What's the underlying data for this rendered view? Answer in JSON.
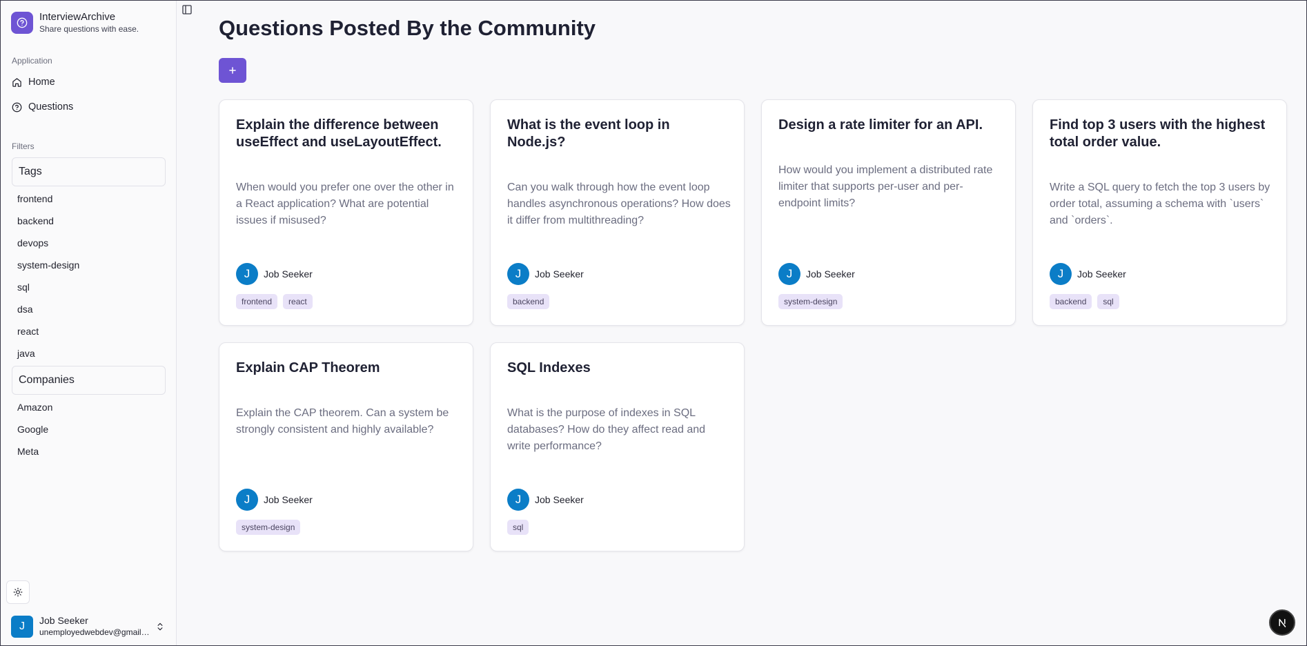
{
  "brand": {
    "name": "InterviewArchive",
    "tagline": "Share questions with ease.",
    "logo_icon": "question-circle-icon",
    "accent": "#6e54d4"
  },
  "sidebar": {
    "application_label": "Application",
    "nav": [
      {
        "label": "Home",
        "icon": "home-icon"
      },
      {
        "label": "Questions",
        "icon": "question-circle-icon"
      }
    ],
    "filters_label": "Filters",
    "tags_header": "Tags",
    "tags": [
      "frontend",
      "backend",
      "devops",
      "system-design",
      "sql",
      "dsa",
      "react",
      "java"
    ],
    "companies_header": "Companies",
    "companies": [
      "Amazon",
      "Google",
      "Meta"
    ],
    "theme_icon": "sun-icon"
  },
  "user": {
    "initial": "J",
    "name": "Job Seeker",
    "email": "unemployedwebdev@gmail.com",
    "avatar_color": "#0b7dc7"
  },
  "main": {
    "title": "Questions Posted By the Community",
    "add_icon": "plus-icon",
    "cards": [
      {
        "title": "Explain the difference between useEffect and useLayoutEffect.",
        "description": "When would you prefer one over the other in a React application? What are potential issues if misused?",
        "author_initial": "J",
        "author": "Job Seeker",
        "tags": [
          "frontend",
          "react"
        ]
      },
      {
        "title": "What is the event loop in Node.js?",
        "description": "Can you walk through how the event loop handles asynchronous operations? How does it differ from multithreading?",
        "author_initial": "J",
        "author": "Job Seeker",
        "tags": [
          "backend"
        ]
      },
      {
        "title": "Design a rate limiter for an API.",
        "description": "How would you implement a distributed rate limiter that supports per-user and per-endpoint limits?",
        "author_initial": "J",
        "author": "Job Seeker",
        "tags": [
          "system-design"
        ]
      },
      {
        "title": "Find top 3 users with the highest total order value.",
        "description": "Write a SQL query to fetch the top 3 users by order total, assuming a schema with `users` and `orders`.",
        "author_initial": "J",
        "author": "Job Seeker",
        "tags": [
          "backend",
          "sql"
        ]
      },
      {
        "title": "Explain CAP Theorem",
        "description": "Explain the CAP theorem. Can a system be strongly consistent and highly available?",
        "author_initial": "J",
        "author": "Job Seeker",
        "tags": [
          "system-design"
        ]
      },
      {
        "title": "SQL Indexes",
        "description": "What is the purpose of indexes in SQL databases? How do they affect read and write performance?",
        "author_initial": "J",
        "author": "Job Seeker",
        "tags": [
          "sql"
        ]
      }
    ]
  },
  "next_badge": {
    "letter": "N"
  }
}
